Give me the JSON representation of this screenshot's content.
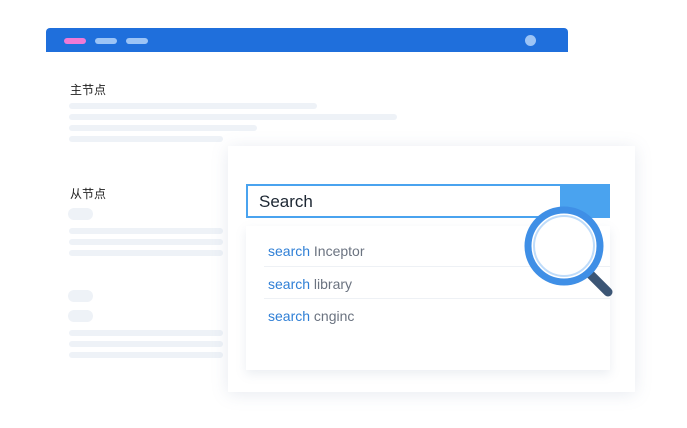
{
  "back_window": {
    "main_node_label": "主节点",
    "child_node_label": "从节点"
  },
  "search": {
    "value": "Search",
    "results": [
      {
        "keyword": "search",
        "term": "Inceptor"
      },
      {
        "keyword": "search",
        "term": "library"
      },
      {
        "keyword": "search",
        "term": "cnginc"
      }
    ]
  },
  "colors": {
    "titlebar": "#1f6fdc",
    "accent": "#4aa3ef",
    "keyword": "#2f7fd6",
    "pink_pill": "#f07ad6"
  },
  "icons": {
    "magnifier": "magnifier-icon"
  }
}
